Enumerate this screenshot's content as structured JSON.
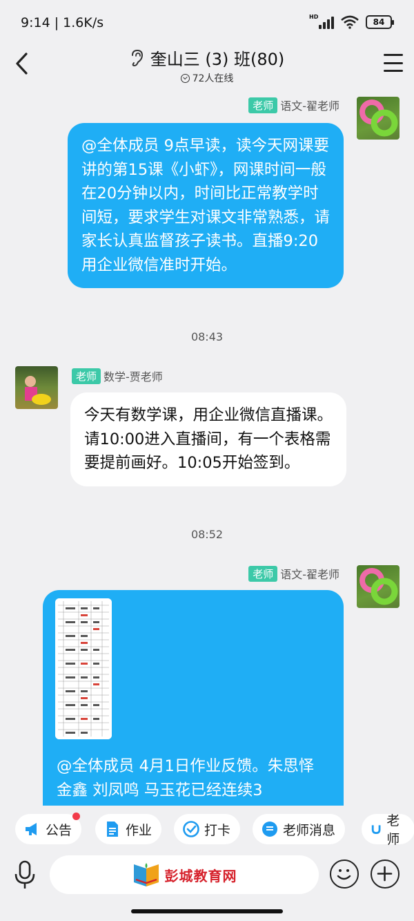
{
  "status_bar": {
    "time_speed": "9:14 | 1.6K/s",
    "network_label": "HD",
    "battery": "84"
  },
  "header": {
    "title": "奎山三 (3) 班(80)",
    "online": "72人在线"
  },
  "messages": [
    {
      "role_badge": "老师",
      "sender": "语文-翟老师",
      "text": "@全体成员 9点早读，读今天网课要讲的第15课《小虾》，网课时间一般在20分钟以内，时间比正常教学时间短，要求学生对课文非常熟悉，请家长认真监督孩子读书。直播9:20用企业微信准时开始。"
    },
    {
      "timestamp": "08:43"
    },
    {
      "role_badge": "老师",
      "sender": "数学-贾老师",
      "text": "今天有数学课，用企业微信直播课。请10:00进入直播间，有一个表格需要提前画好。10:05开始签到。"
    },
    {
      "timestamp": "08:52"
    },
    {
      "role_badge": "老师",
      "sender": "语文-翟老师",
      "text": "@全体成员 4月1日作业反馈。朱思怿 金鑫 刘凤鸣 马玉花已经连续3"
    }
  ],
  "quick_actions": [
    "公告",
    "作业",
    "打卡",
    "老师消息",
    "老师"
  ],
  "input": {
    "watermark": "彭城教育网"
  },
  "colors": {
    "outgoing_bubble": "#1faef5",
    "badge": "#3cc9a8",
    "notice_dot": "#f23b4a"
  }
}
